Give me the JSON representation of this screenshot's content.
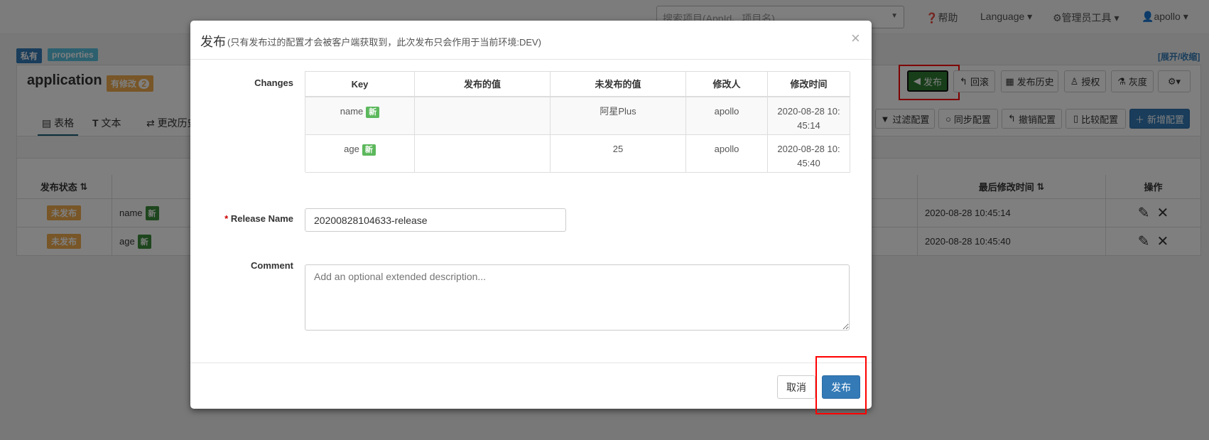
{
  "navbar": {
    "search_placeholder": "搜索项目(AppId、项目名)",
    "help": "帮助",
    "language": "Language",
    "admin_tools": "管理员工具",
    "user": "apollo"
  },
  "namespace": {
    "scope_badge": "私有",
    "format_badge": "properties",
    "expand_collapse": "[展开/收缩]",
    "name": "application",
    "modified_badge": "有修改",
    "modified_count": "2",
    "tabs": [
      {
        "label": "表格"
      },
      {
        "label": "文本"
      },
      {
        "label": "更改历史"
      }
    ],
    "actions": {
      "publish": "发布",
      "rollback": "回滚",
      "history": "发布历史",
      "grant": "授权",
      "gray": "灰度"
    },
    "toolbar": {
      "filter": "过滤配置",
      "sync": "同步配置",
      "revoke": "撤销配置",
      "compare": "比较配置",
      "add": "新增配置"
    },
    "table": {
      "headers": {
        "status": "发布状态",
        "key": "Key",
        "modifier": "修改人",
        "modified_time": "最后修改时间",
        "ops": "操作"
      },
      "rows": [
        {
          "status": "未发布",
          "key": "name",
          "new": "新",
          "time": "2020-08-28 10:45:14"
        },
        {
          "status": "未发布",
          "key": "age",
          "new": "新",
          "time": "2020-08-28 10:45:40"
        }
      ]
    }
  },
  "modal": {
    "title": "发布",
    "subtitle": "(只有发布过的配置才会被客户端获取到，此次发布只会作用于当前环境:DEV)",
    "close": "×",
    "changes_label": "Changes",
    "changes_headers": [
      "Key",
      "发布的值",
      "未发布的值",
      "修改人",
      "修改时间"
    ],
    "changes": [
      {
        "key": "name",
        "new": "新",
        "published": "",
        "unpublished": "阿星Plus",
        "modifier": "apollo",
        "time": "2020-08-28 10:45:14"
      },
      {
        "key": "age",
        "new": "新",
        "published": "",
        "unpublished": "25",
        "modifier": "apollo",
        "time": "2020-08-28 10:45:40"
      }
    ],
    "release_name_label": "Release Name",
    "required_mark": "*",
    "release_name_value": "20200828104633-release",
    "comment_label": "Comment",
    "comment_placeholder": "Add an optional extended description...",
    "cancel": "取消",
    "submit": "发布"
  }
}
